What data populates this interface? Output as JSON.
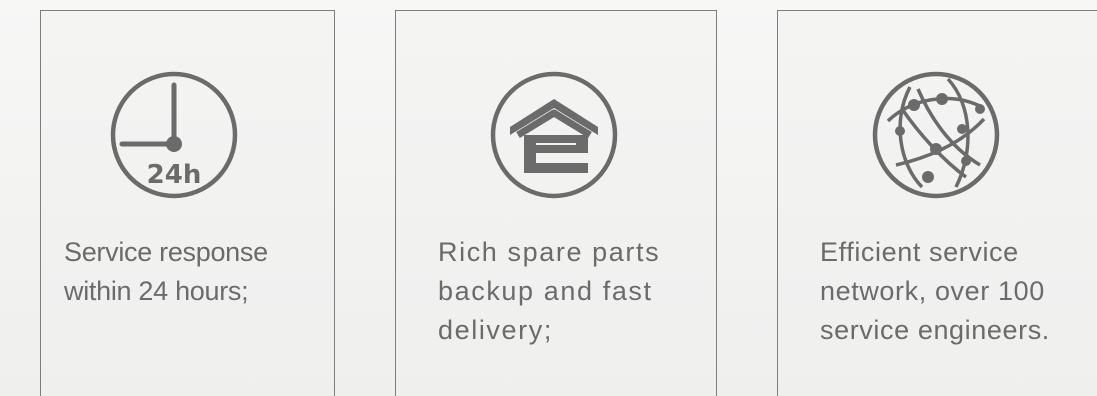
{
  "colors": {
    "border": "#7d7d7d",
    "icon": "#6b6b6b",
    "text": "#6b6b6b",
    "background": "#f3f3f2"
  },
  "cards": [
    {
      "icon": "clock-24h-icon",
      "icon_label": "24h",
      "lines": [
        "Service response",
        "within 24 hours;"
      ]
    },
    {
      "icon": "warehouse-icon",
      "lines": [
        "Rich spare parts",
        "backup and fast",
        "delivery;"
      ]
    },
    {
      "icon": "globe-network-icon",
      "lines": [
        "Efficient service",
        "network, over 100",
        "service engineers."
      ]
    }
  ]
}
